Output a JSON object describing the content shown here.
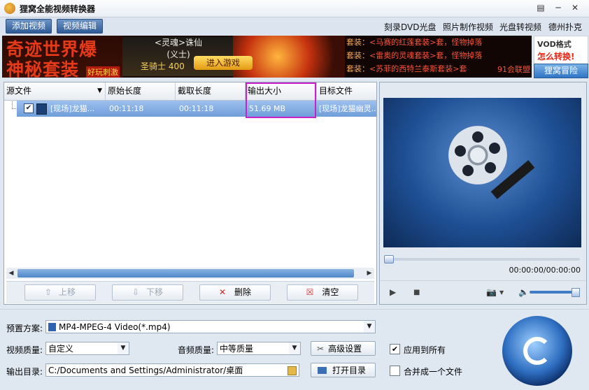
{
  "window": {
    "title": "狸窝全能视频转换器",
    "menu_glyph": "▤",
    "minimize_glyph": "─",
    "close_glyph": "✕"
  },
  "toolbar": {
    "add_video": "添加视频",
    "edit_video": "视频编辑",
    "links": [
      "刻录DVD光盘",
      "照片制作视频",
      "光盘转视频",
      "德州扑克"
    ]
  },
  "banner": {
    "big_line1": "奇迹世界爆",
    "big_line2": "神秘套装",
    "tag": "好玩刺激",
    "mid_line1": "<灵魂>诛仙",
    "mid_line2": "(义士)",
    "mid_line3": "圣骑士 400",
    "play": "进入游戏",
    "right_lines": [
      {
        "prefix": "套装：",
        "text": "<马赛的红莲套装>套，怪物掉落"
      },
      {
        "prefix": "套装：",
        "text": "<雷奥的灵魂套装>套，怪物掉落"
      },
      {
        "prefix": "套装：",
        "text": "<苏菲的西特兰泰斯套装>套"
      }
    ],
    "union": "91会联盟"
  },
  "ads": {
    "vod_line1": "VOD格式",
    "vod_line2": "怎么转换!",
    "help": "狸窝冒险"
  },
  "table": {
    "headers": [
      "源文件",
      "原始长度",
      "截取长度",
      "输出大小",
      "目标文件"
    ],
    "row": {
      "source": "[现场]龙猫...",
      "original_length": "00:11:18",
      "cut_length": "00:11:18",
      "output_size": "51.69 MB",
      "target": "[现场]龙猫幽灵..."
    }
  },
  "list_buttons": {
    "up": "上移",
    "down": "下移",
    "delete": "删除",
    "clear": "清空"
  },
  "preview": {
    "time": "00:00:00/00:00:00",
    "seek_progress": 0,
    "volume": 0.9
  },
  "settings": {
    "preset_label": "预置方案:",
    "preset_value": "MP4-MPEG-4 Video(*.mp4)",
    "video_quality_label": "视频质量:",
    "video_quality_value": "自定义",
    "audio_quality_label": "音频质量:",
    "audio_quality_value": "中等质量",
    "advanced_button": "高级设置",
    "apply_all_label": "应用到所有",
    "apply_all_checked": true,
    "output_dir_label": "输出目录:",
    "output_dir_value": "C:/Documents and Settings/Administrator/桌面",
    "open_dir_button": "打开目录",
    "merge_label": "合并成一个文件",
    "merge_checked": false
  }
}
